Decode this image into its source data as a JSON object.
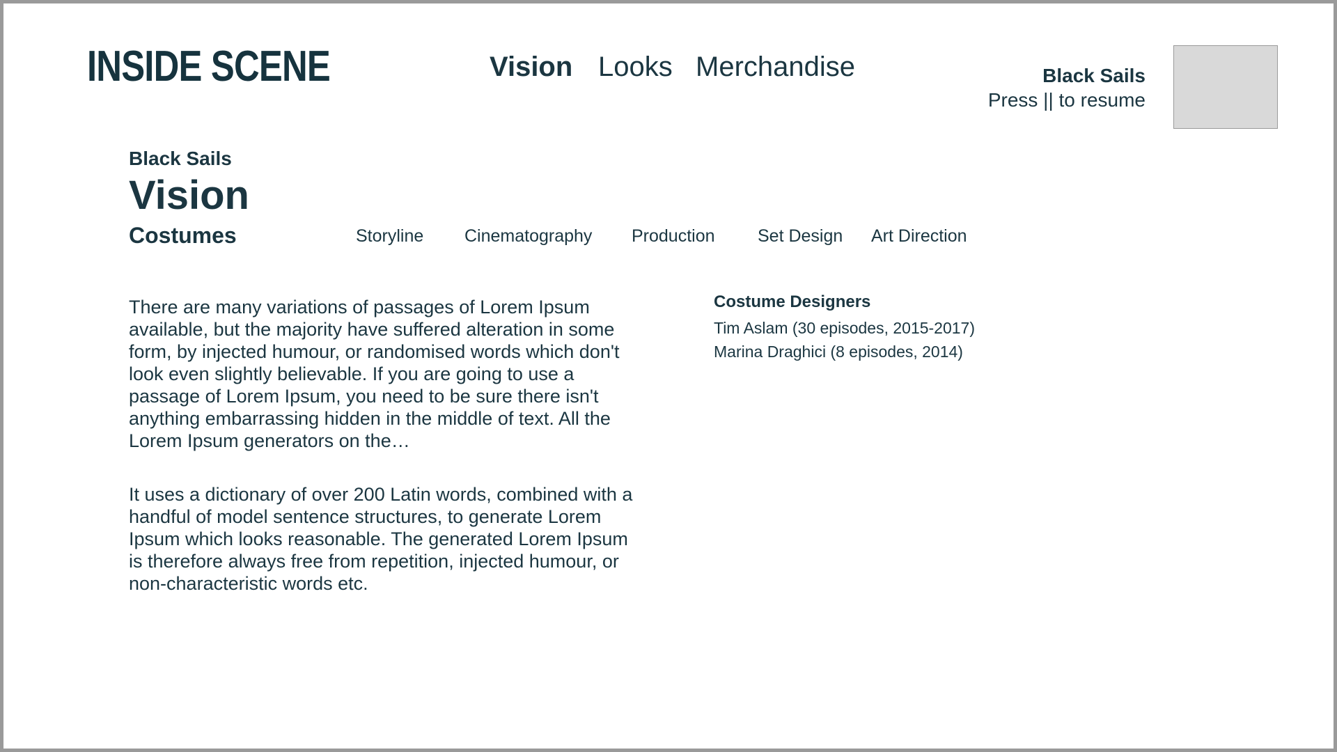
{
  "header": {
    "logo": "INSIDE SCENE",
    "nav": [
      {
        "label": "Vision",
        "active": true
      },
      {
        "label": "Looks",
        "active": false
      },
      {
        "label": "Merchandise",
        "active": false
      }
    ],
    "now_playing": {
      "title": "Black Sails",
      "hint": "Press || to resume"
    }
  },
  "section": {
    "show": "Black Sails",
    "title": "Vision",
    "current_sub": "Costumes",
    "sub_nav": [
      "Storyline",
      "Cinematography",
      "Production",
      "Set Design",
      "Art Direction"
    ]
  },
  "content": {
    "paragraphs": [
      "There are many variations of passages of Lorem Ipsum available, but the majority have suffered alteration in some form, by injected humour, or randomised words which don't look even slightly believable. If you are going to use a passage of Lorem Ipsum, you need to be sure there isn't anything embarrassing hidden in the middle of text. All the Lorem Ipsum generators on the…",
      "It uses a dictionary of over 200 Latin words, combined with a handful of model sentence structures, to generate Lorem Ipsum which looks reasonable. The generated Lorem Ipsum is therefore always free from repetition, injected humour, or non-characteristic words etc."
    ],
    "designers": {
      "heading": "Costume Designers",
      "items": [
        "Tim Aslam (30 episodes, 2015-2017)",
        "Marina Draghici (8 episodes, 2014)"
      ]
    }
  },
  "colors": {
    "text": "#1b3641",
    "frame": "#9a9a9a",
    "thumbnail": "#d9d9d9"
  }
}
